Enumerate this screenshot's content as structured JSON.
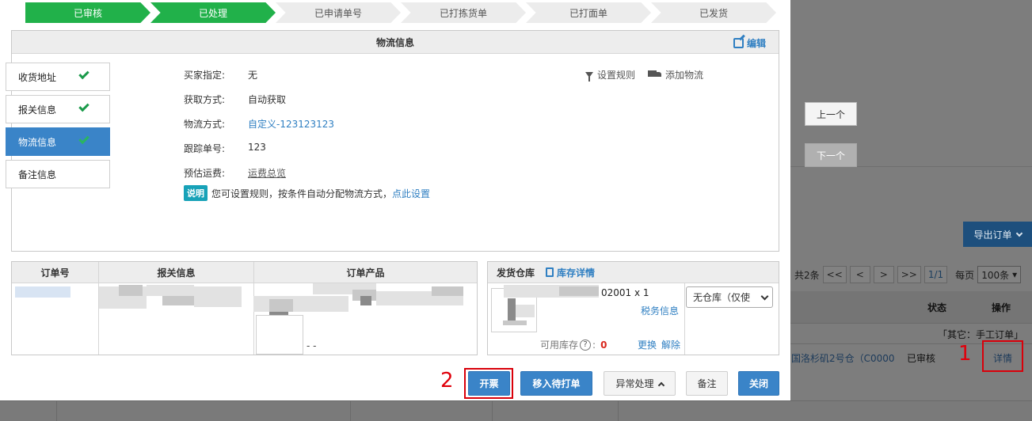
{
  "steps": [
    {
      "label": "已审核",
      "done": true
    },
    {
      "label": "已处理",
      "done": true
    },
    {
      "label": "已申请单号",
      "done": false
    },
    {
      "label": "已打拣货单",
      "done": false
    },
    {
      "label": "已打面单",
      "done": false
    },
    {
      "label": "已发货",
      "done": false
    }
  ],
  "panel": {
    "title": "物流信息",
    "edit_label": "编辑"
  },
  "side_tabs": [
    {
      "label": "收货地址",
      "checked": true
    },
    {
      "label": "报关信息",
      "checked": true
    },
    {
      "label": "物流信息",
      "checked": true
    },
    {
      "label": "备注信息",
      "checked": false
    }
  ],
  "logistics": {
    "buyer_label": "买家指定:",
    "buyer_value": "无",
    "acquire_label": "获取方式:",
    "acquire_value": "自动获取",
    "method_label": "物流方式:",
    "method_value": "自定义-123123123",
    "tracking_label": "跟踪单号:",
    "tracking_value": "123",
    "freight_label": "预估运费:",
    "freight_value": "运费总览"
  },
  "tools": {
    "rule_label": "设置规则",
    "add_label": "添加物流"
  },
  "note": {
    "badge": "说明",
    "text": "您可设置规则，按条件自动分配物流方式，",
    "link": "点此设置"
  },
  "order_table": {
    "headers": [
      "订单号",
      "报关信息",
      "订单产品"
    ],
    "dash": "- -"
  },
  "warehouse": {
    "header": "发货仓库",
    "inventory_link": "库存详情",
    "sku_qty": "02001 x 1",
    "tax_link": "税务信息",
    "stock_label": "可用库存",
    "stock_help": "?",
    "stock_colon": ":",
    "stock_value": "0",
    "replace": "更换",
    "remove": "解除",
    "select_value": "无仓库（仅使"
  },
  "footer": {
    "invoice": "开票",
    "move_pending": "移入待打单",
    "exception": "异常处理",
    "remark": "备注",
    "close": "关闭"
  },
  "background": {
    "prev": "上一个",
    "next": "下一个",
    "export": "导出订单",
    "total": "共2条",
    "pager": [
      "<<",
      "<",
      ">",
      ">>"
    ],
    "page": "1/1",
    "per_page_label": "每页",
    "per_page": "100条",
    "col_status": "状态",
    "col_op": "操作",
    "group_label": "「其它：手工订单」",
    "warehouse_cell": "国洛杉矶2号仓（C0000",
    "status_cell": "已审核",
    "detail_link": "详情"
  },
  "annotations": {
    "one": "1",
    "two": "2"
  },
  "colors": {
    "primary": "#3a84c8",
    "step_done": "#21b14a",
    "annotation": "#d9000a"
  }
}
